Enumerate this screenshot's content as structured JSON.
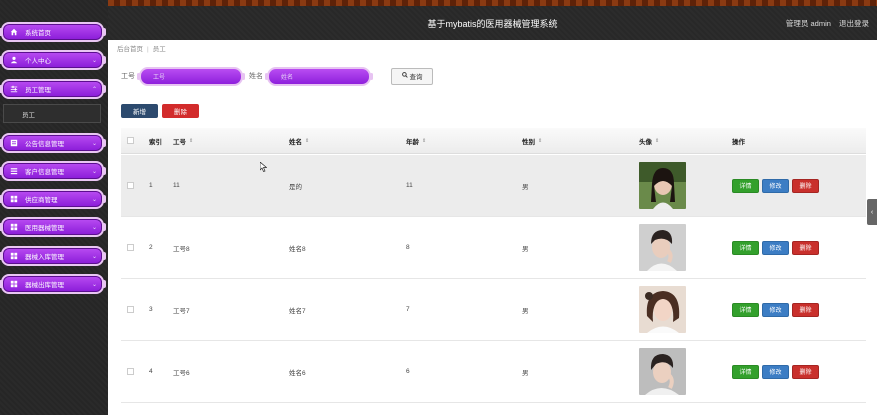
{
  "header": {
    "title": "基于mybatis的医用器械管理系统",
    "role": "管理员 admin",
    "logout": "退出登录"
  },
  "sidebar": {
    "items": [
      {
        "label": "系统首页",
        "icon": "home-icon"
      },
      {
        "label": "个人中心",
        "icon": "user-icon"
      },
      {
        "label": "员工管理",
        "icon": "sliders-icon"
      },
      {
        "label": "公告信息管理",
        "icon": "doc-icon"
      },
      {
        "label": "客户信息管理",
        "icon": "list-icon"
      },
      {
        "label": "供应商管理",
        "icon": "grid-icon"
      },
      {
        "label": "医用器械管理",
        "icon": "grid-icon"
      },
      {
        "label": "器械入库管理",
        "icon": "grid-icon"
      },
      {
        "label": "器械出库管理",
        "icon": "grid-icon"
      }
    ],
    "sub_item": "员工"
  },
  "breadcrumb": {
    "home": "后台首页",
    "current": "员工"
  },
  "search": {
    "label1": "工号",
    "placeholder1": "工号",
    "label2": "姓名",
    "placeholder2": "姓名",
    "button": "查询"
  },
  "actions": {
    "add": "新增",
    "delete": "删除"
  },
  "table": {
    "headers": [
      "索引",
      "工号",
      "姓名",
      "年龄",
      "性别",
      "头像",
      "操作"
    ],
    "rows": [
      {
        "index": "1",
        "id": "11",
        "name": "是的",
        "age": "11",
        "gender": "男"
      },
      {
        "index": "2",
        "id": "工号8",
        "name": "姓名8",
        "age": "8",
        "gender": "男"
      },
      {
        "index": "3",
        "id": "工号7",
        "name": "姓名7",
        "age": "7",
        "gender": "男"
      },
      {
        "index": "4",
        "id": "工号6",
        "name": "姓名6",
        "age": "6",
        "gender": "男"
      }
    ],
    "ops": {
      "detail": "详情",
      "edit": "修改",
      "delete": "删除"
    }
  },
  "colors": {
    "accent": "#9b30e6",
    "sidebar_bg": "#282828",
    "detail": "#33a02c",
    "edit": "#3c7dc4",
    "danger": "#c9302c"
  }
}
